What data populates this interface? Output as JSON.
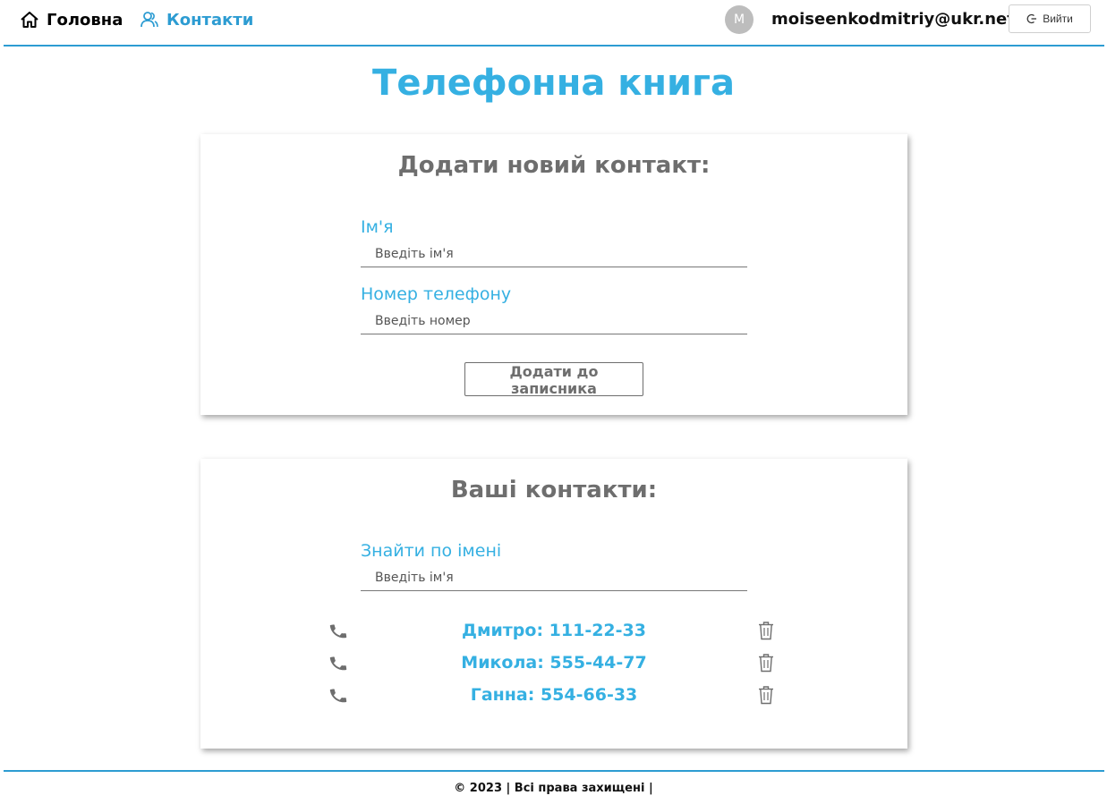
{
  "nav": {
    "home_label": "Головна",
    "contacts_label": "Контакти"
  },
  "user": {
    "avatar_letter": "M",
    "email": "moiseenkodmitriy@ukr.net",
    "logout_label": "Вийти"
  },
  "page": {
    "title": "Телефонна книга"
  },
  "add_form": {
    "title": "Додати новий контакт:",
    "name_label": "Ім'я",
    "name_placeholder": "Введіть ім'я",
    "phone_label": "Номер телефону",
    "phone_placeholder": "Введіть номер",
    "submit_label": "Додати до записника"
  },
  "contacts": {
    "title": "Ваші контакти:",
    "search_label": "Знайти по імені",
    "search_placeholder": "Введіть ім'я",
    "items": [
      {
        "text": "Дмитро: 111-22-33"
      },
      {
        "text": "Микола: 555-44-77"
      },
      {
        "text": "Ганна: 554-66-33"
      }
    ]
  },
  "footer": {
    "text": "© 2023 | Всі права захищені |"
  },
  "colors": {
    "accent": "#35b0e2",
    "nav_active": "#2d9cd2",
    "muted": "#6e6e6e"
  },
  "icons": {
    "home": "home-icon",
    "contacts": "users-icon",
    "logout": "logout-icon",
    "phone": "phone-icon",
    "delete": "trash-icon"
  }
}
